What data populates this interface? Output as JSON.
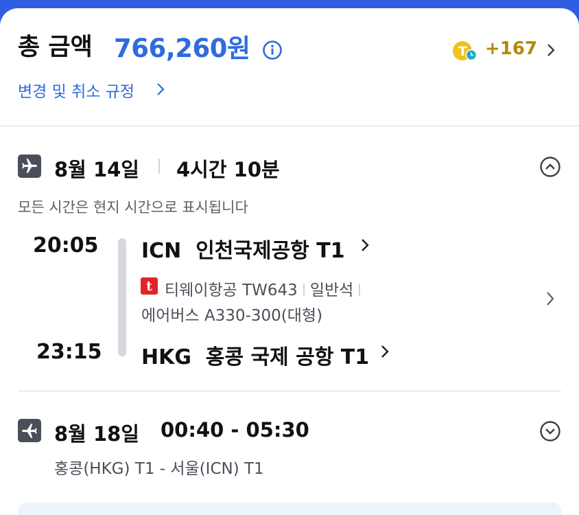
{
  "colors": {
    "brand_blue": "#2e6bde",
    "points_gold": "#b38a0a",
    "airline_red": "#e0242a",
    "top_bar_blue": "#2f5fe0"
  },
  "header": {
    "total_label": "총 금액",
    "total_amount": "766,260원",
    "info_icon": "info-circle-icon",
    "points": "+167",
    "points_icon": "t-coin-icon",
    "rules_link": "변경 및 취소 규정"
  },
  "outbound": {
    "date": "8월 14일",
    "duration": "4시간 10분",
    "toggle_icon": "chevron-up-circle-icon",
    "timezone_note": "모든 시간은 현지 시간으로 표시됩니다",
    "departure": {
      "time": "20:05",
      "code": "ICN",
      "airport": "인천국제공항 T1"
    },
    "arrival": {
      "time": "23:15",
      "code": "HKG",
      "airport": "홍콩 국제 공항 T1"
    },
    "airline_logo": "t",
    "airline": "티웨이항공",
    "flight_no": "TW643",
    "cabin": "일반석",
    "aircraft": "에어버스 A330-300(대형)"
  },
  "return": {
    "date": "8월 18일",
    "times": "00:40 - 05:30",
    "toggle_icon": "chevron-down-circle-icon",
    "route": "홍콩(HKG) T1 - 서울(ICN) T1"
  }
}
